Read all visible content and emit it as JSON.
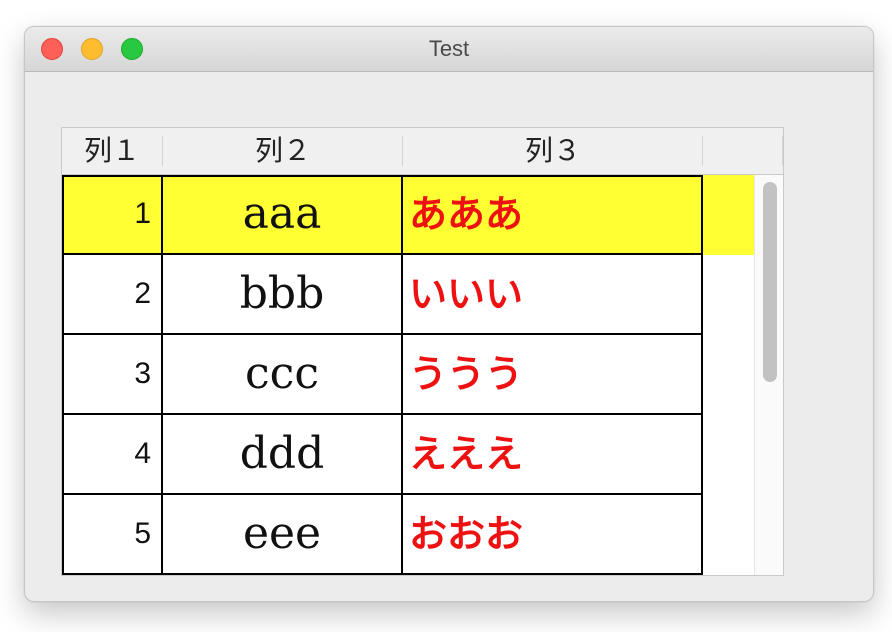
{
  "window": {
    "title": "Test"
  },
  "table": {
    "columns": [
      "列１",
      "列２",
      "列３"
    ],
    "rows": [
      {
        "col1": "1",
        "col2": "aaa",
        "col3": "あああ",
        "selected": true
      },
      {
        "col1": "2",
        "col2": "bbb",
        "col3": "いいい",
        "selected": false
      },
      {
        "col1": "3",
        "col2": "ccc",
        "col3": "ううう",
        "selected": false
      },
      {
        "col1": "4",
        "col2": "ddd",
        "col3": "えええ",
        "selected": false
      },
      {
        "col1": "5",
        "col2": "eee",
        "col3": "おおお",
        "selected": false
      }
    ]
  },
  "colors": {
    "selected_row": "#ffff33",
    "col3_text": "#ee1111",
    "close": "#fe5f57",
    "minimize": "#febc2e",
    "zoom": "#28c840"
  },
  "icons": {
    "close": "close-icon",
    "minimize": "minimize-icon",
    "zoom": "zoom-icon"
  }
}
